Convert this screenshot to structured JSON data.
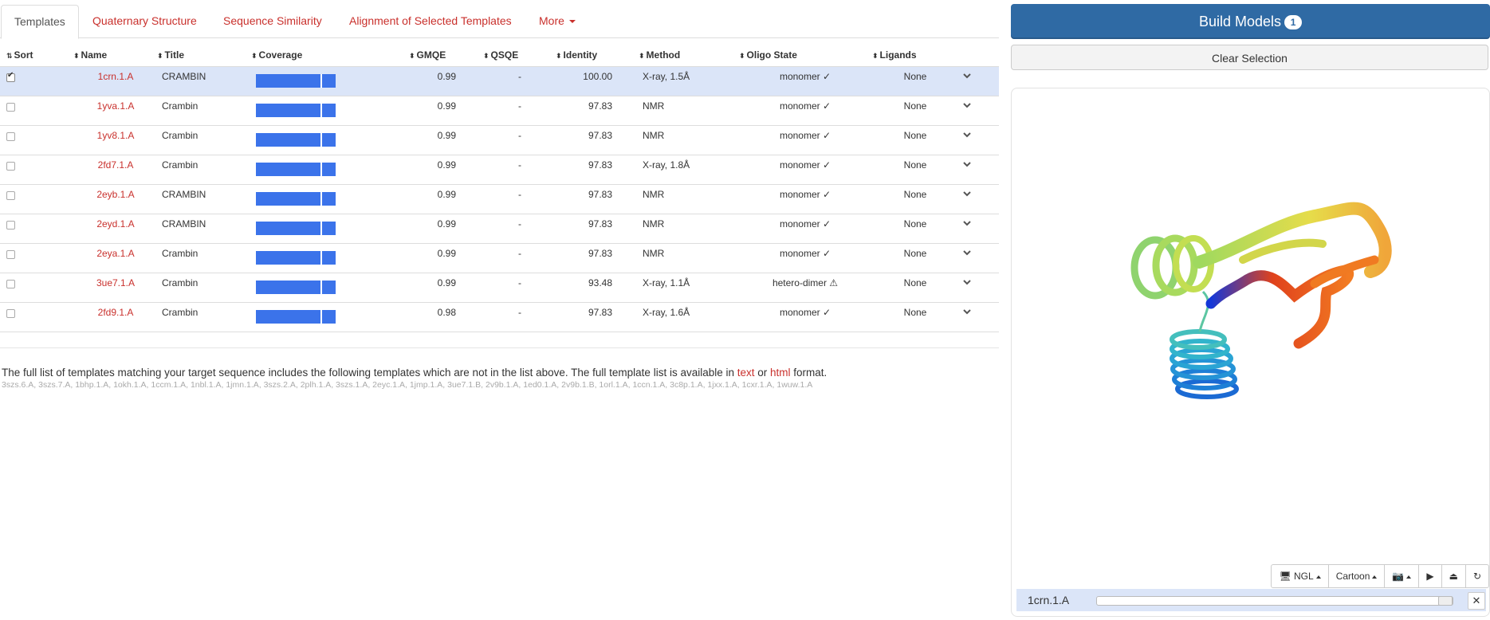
{
  "tabs": [
    {
      "label": "Templates",
      "active": true
    },
    {
      "label": "Quaternary Structure"
    },
    {
      "label": "Sequence Similarity"
    },
    {
      "label": "Alignment of Selected Templates"
    },
    {
      "label": "More"
    }
  ],
  "table": {
    "headers": [
      "Sort",
      "Name",
      "Title",
      "Coverage",
      "GMQE",
      "QSQE",
      "Identity",
      "Method",
      "Oligo State",
      "Ligands"
    ],
    "rows": [
      {
        "selected": true,
        "name": "1crn.1.A",
        "title": "CRAMBIN",
        "coverage": 1.0,
        "gmqe": "0.99",
        "qsqe": "-",
        "identity": "100.00",
        "method": "X-ray, 1.5Å",
        "oligo": "monomer ✓",
        "ligands": "None"
      },
      {
        "selected": false,
        "name": "1yva.1.A",
        "title": "Crambin",
        "coverage": 1.0,
        "gmqe": "0.99",
        "qsqe": "-",
        "identity": "97.83",
        "method": "NMR",
        "oligo": "monomer ✓",
        "ligands": "None"
      },
      {
        "selected": false,
        "name": "1yv8.1.A",
        "title": "Crambin",
        "coverage": 1.0,
        "gmqe": "0.99",
        "qsqe": "-",
        "identity": "97.83",
        "method": "NMR",
        "oligo": "monomer ✓",
        "ligands": "None"
      },
      {
        "selected": false,
        "name": "2fd7.1.A",
        "title": "Crambin",
        "coverage": 1.0,
        "gmqe": "0.99",
        "qsqe": "-",
        "identity": "97.83",
        "method": "X-ray, 1.8Å",
        "oligo": "monomer ✓",
        "ligands": "None"
      },
      {
        "selected": false,
        "name": "2eyb.1.A",
        "title": "CRAMBIN",
        "coverage": 1.0,
        "gmqe": "0.99",
        "qsqe": "-",
        "identity": "97.83",
        "method": "NMR",
        "oligo": "monomer ✓",
        "ligands": "None"
      },
      {
        "selected": false,
        "name": "2eyd.1.A",
        "title": "CRAMBIN",
        "coverage": 1.0,
        "gmqe": "0.99",
        "qsqe": "-",
        "identity": "97.83",
        "method": "NMR",
        "oligo": "monomer ✓",
        "ligands": "None"
      },
      {
        "selected": false,
        "name": "2eya.1.A",
        "title": "Crambin",
        "coverage": 1.0,
        "gmqe": "0.99",
        "qsqe": "-",
        "identity": "97.83",
        "method": "NMR",
        "oligo": "monomer ✓",
        "ligands": "None"
      },
      {
        "selected": false,
        "name": "3ue7.1.A",
        "title": "Crambin",
        "coverage": 1.0,
        "gmqe": "0.99",
        "qsqe": "-",
        "identity": "93.48",
        "method": "X-ray, 1.1Å",
        "oligo": "hetero-dimer ⚠",
        "ligands": "None"
      },
      {
        "selected": false,
        "name": "2fd9.1.A",
        "title": "Crambin",
        "coverage": 1.0,
        "gmqe": "0.98",
        "qsqe": "-",
        "identity": "97.83",
        "method": "X-ray, 1.6Å",
        "oligo": "monomer ✓",
        "ligands": "None"
      }
    ]
  },
  "note": {
    "text_before": "The full list of templates matching your target sequence includes the following templates which are not in the list above. The full template list is available in ",
    "link_text": "text",
    "or": " or ",
    "link_html": "html",
    "text_after": " format.",
    "extra_templates": "3szs.6.A, 3szs.7.A, 1bhp.1.A, 1okh.1.A, 1ccm.1.A, 1nbl.1.A, 1jmn.1.A, 3szs.2.A, 2plh.1.A, 3szs.1.A, 2eyc.1.A, 1jmp.1.A, 3ue7.1.B, 2v9b.1.A, 1ed0.1.A, 2v9b.1.B, 1orl.1.A, 1ccn.1.A, 3c8p.1.A, 1jxx.1.A, 1cxr.1.A, 1wuw.1.A"
  },
  "right": {
    "build_label": "Build Models",
    "build_count": "1",
    "clear_label": "Clear Selection",
    "viewer_buttons": {
      "engine": "NGL",
      "style": "Cartoon"
    },
    "status_label": "1crn.1.A",
    "coverage_color": "#3b73ea",
    "accent": "#c9302c",
    "primary": "#2f6aa4"
  }
}
